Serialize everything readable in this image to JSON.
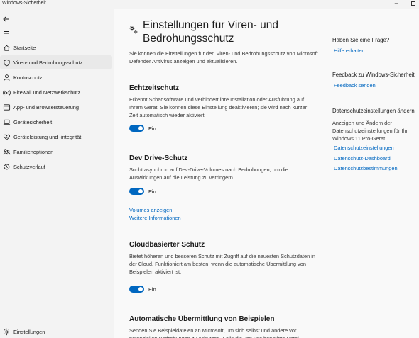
{
  "window": {
    "title": "Windows-Sicherheit",
    "minimize": "–"
  },
  "sidebar": {
    "items": [
      {
        "label": "Startseite",
        "icon": "home-icon"
      },
      {
        "label": "Viren- und Bedrohungsschutz",
        "icon": "shield-icon",
        "active": true
      },
      {
        "label": "Kontoschutz",
        "icon": "person-icon"
      },
      {
        "label": "Firewall und Netzwerkschutz",
        "icon": "wifi-icon"
      },
      {
        "label": "App- und Browsersteuerung",
        "icon": "browser-icon"
      },
      {
        "label": "Gerätesicherheit",
        "icon": "laptop-icon"
      },
      {
        "label": "Geräteleistung und -integrität",
        "icon": "heart-icon"
      },
      {
        "label": "Familienoptionen",
        "icon": "family-icon"
      },
      {
        "label": "Schutzverlauf",
        "icon": "history-icon"
      }
    ],
    "settings_label": "Einstellungen"
  },
  "main": {
    "title": "Einstellungen für Viren- und Bedrohungsschutz",
    "description": "Sie können die Einstellungen für den Viren- und Bedrohungsschutz von Microsoft Defender Antivirus anzeigen und aktualisieren.",
    "sections": [
      {
        "title": "Echtzeitschutz",
        "description": "Erkennt Schadsoftware und verhindert ihre Installation oder Ausführung auf Ihrem Gerät. Sie können diese Einstellung deaktivieren; sie wird nach kurzer Zeit automatisch wieder aktiviert.",
        "toggle_label": "Ein"
      },
      {
        "title": "Dev Drive-Schutz",
        "description": "Sucht asynchron auf Dev-Drive-Volumes nach Bedrohungen, um die Auswirkungen auf die Leistung zu verringern.",
        "toggle_label": "Ein",
        "links": [
          "Volumes anzeigen",
          "Weitere Informationen"
        ]
      },
      {
        "title": "Cloudbasierter Schutz",
        "description": "Bietet höheren und besseren Schutz mit Zugriff auf die neuesten Schutzdaten in der Cloud. Funktioniert am besten, wenn die automatische Übermittlung von Beispielen aktiviert ist.",
        "toggle_label": "Ein"
      },
      {
        "title": "Automatische Übermittlung von Beispielen",
        "description": "Senden Sie Beispieldateien an Microsoft, um sich selbst und andere vor potenziellen Bedrohungen zu schützen. Falls die von uns benötigte Datei"
      }
    ]
  },
  "right_panel": {
    "question_heading": "Haben Sie eine Frage?",
    "help_link": "Hilfe erhalten",
    "feedback_heading": "Feedback zu Windows-Sicherheit",
    "feedback_link": "Feedback senden",
    "privacy_heading": "Datenschutzeinstellungen ändern",
    "privacy_text": "Anzeigen und Ändern der Datenschutzeinstellungen für Ihr Windows 11 Pro-Gerät.",
    "privacy_links": [
      "Datenschutzeinstellungen",
      "Datenschutz-Dashboard",
      "Datenschutzbestimmungen"
    ]
  },
  "colors": {
    "accent": "#0067c0",
    "sidebar_bg": "#f3f3f3",
    "content_bg": "#f9f9f9"
  }
}
